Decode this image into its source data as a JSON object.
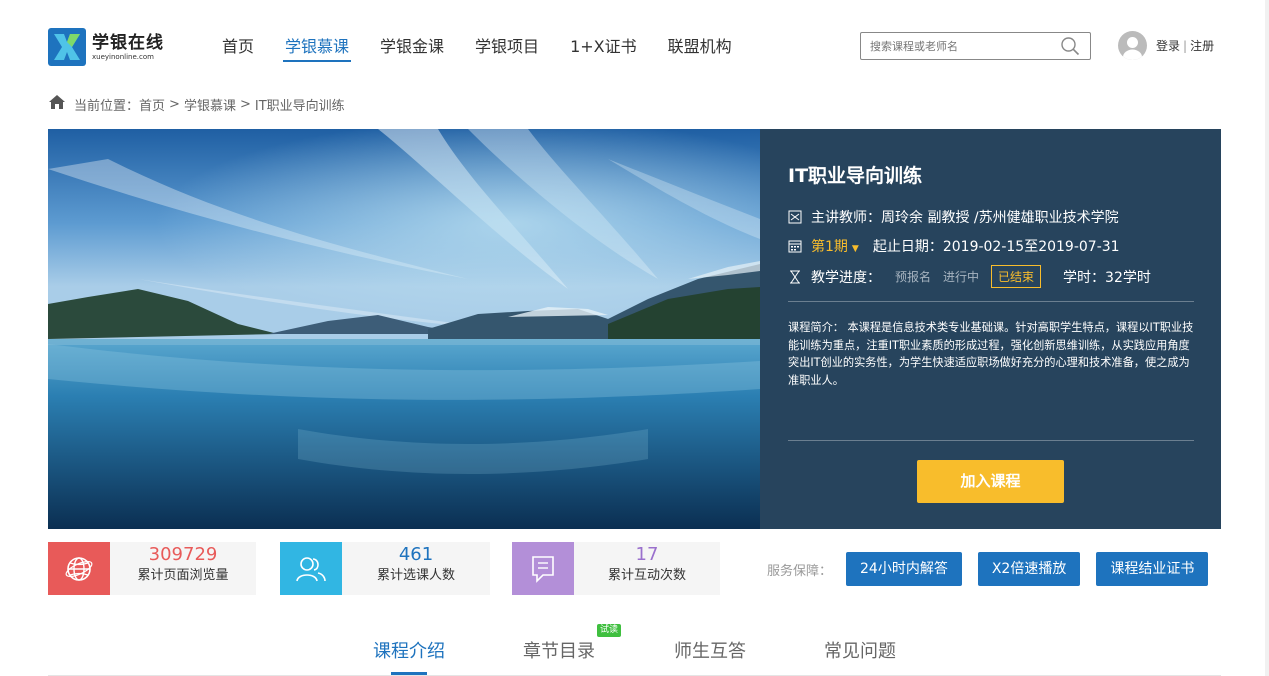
{
  "header": {
    "logo_cn": "学银在线",
    "logo_en": "xueyinonline.com",
    "nav": [
      {
        "label": "首页",
        "active": false
      },
      {
        "label": "学银慕课",
        "active": true
      },
      {
        "label": "学银金课",
        "active": false
      },
      {
        "label": "学银项目",
        "active": false
      },
      {
        "label": "1+X证书",
        "active": false
      },
      {
        "label": "联盟机构",
        "active": false
      }
    ],
    "search_placeholder": "搜索课程或老师名",
    "login_label": "登录",
    "separator": "|",
    "register_label": "注册"
  },
  "breadcrumb": {
    "prefix": "当前位置：",
    "items": [
      "首页",
      "学银慕课",
      "IT职业导向训练"
    ],
    "sep": ">"
  },
  "course": {
    "title": "IT职业导向训练",
    "teacher": "主讲教师：周玲余 副教授 /苏州健雄职业技术学院",
    "period": "第1期",
    "date_range": "起止日期：2019-02-15至2019-07-31",
    "progress_label": "教学进度：",
    "stages": [
      "预报名",
      "进行中",
      "已结束"
    ],
    "current_stage": "已结束",
    "hours": "学时：32学时",
    "intro": "课程简介： 本课程是信息技术类专业基础课。针对高职学生特点，课程以IT职业技能训练为重点，注重IT职业素质的形成过程，强化创新思维训练，从实践应用角度突出IT创业的实务性，为学生快速适应职场做好充分的心理和技术准备，使之成为准职业人。",
    "join_label": "加入课程"
  },
  "stats": [
    {
      "value": "309729",
      "label": "累计页面浏览量",
      "icon": "globe-icon",
      "color": "#e85a59"
    },
    {
      "value": "461",
      "label": "累计选课人数",
      "icon": "users-icon",
      "color": "#31b6e3"
    },
    {
      "value": "17",
      "label": "累计互动次数",
      "icon": "chat-icon",
      "color": "#b38fd8"
    }
  ],
  "service": {
    "label": "服务保障：",
    "buttons": [
      "24小时内解答",
      "X2倍速播放",
      "课程结业证书"
    ]
  },
  "tabs": [
    {
      "label": "课程介绍",
      "active": true
    },
    {
      "label": "章节目录",
      "active": false
    },
    {
      "label": "师生互答",
      "active": false
    },
    {
      "label": "常见问题",
      "active": false
    }
  ],
  "trial_badge": "试读",
  "colors": {
    "brand_blue": "#1e73be",
    "panel_bg": "#27445d",
    "accent_yellow": "#f8bd2c"
  }
}
